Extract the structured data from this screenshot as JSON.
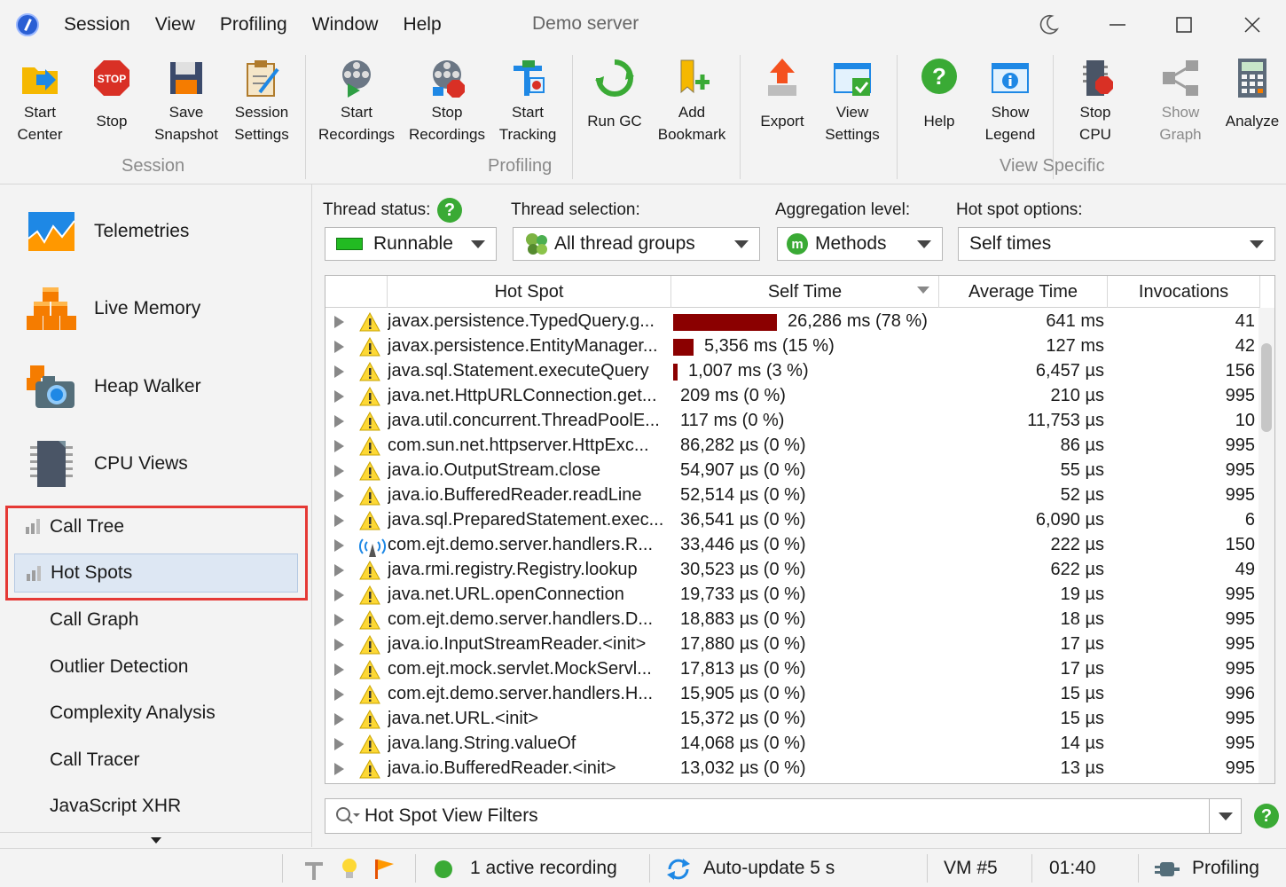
{
  "menu": [
    "Session",
    "View",
    "Profiling",
    "Window",
    "Help"
  ],
  "window_title": "Demo server",
  "ribbon": {
    "buttons": [
      {
        "label": "Start\nCenter",
        "icon": "folder-arrow-icon"
      },
      {
        "label": "Stop",
        "icon": "stop-sign-icon"
      },
      {
        "label": "Save\nSnapshot",
        "icon": "floppy-disk-icon"
      },
      {
        "label": "Session\nSettings",
        "icon": "clipboard-pencil-icon"
      },
      {
        "label": "Start\nRecordings",
        "icon": "film-reel-play-icon"
      },
      {
        "label": "Stop\nRecordings",
        "icon": "film-reel-stop-icon"
      },
      {
        "label": "Start\nTracking",
        "icon": "tracking-icon"
      },
      {
        "label": "Run GC",
        "icon": "recycle-icon"
      },
      {
        "label": "Add\nBookmark",
        "icon": "bookmark-add-icon"
      },
      {
        "label": "Export",
        "icon": "export-arrow-icon"
      },
      {
        "label": "View\nSettings",
        "icon": "view-settings-icon"
      },
      {
        "label": "Help",
        "icon": "help-icon"
      },
      {
        "label": "Show\nLegend",
        "icon": "legend-info-icon"
      },
      {
        "label": "Stop\nCPU",
        "icon": "cpu-stop-icon"
      },
      {
        "label": "Show\nGraph",
        "icon": "graph-share-icon"
      },
      {
        "label": "Analyze",
        "icon": "calculator-icon"
      }
    ],
    "groups": [
      "Session",
      "Profiling",
      "View Specific"
    ]
  },
  "sidebar": {
    "main": [
      {
        "label": "Telemetries",
        "icon": "telemetries-icon"
      },
      {
        "label": "Live Memory",
        "icon": "live-memory-icon"
      },
      {
        "label": "Heap Walker",
        "icon": "heap-walker-icon"
      },
      {
        "label": "CPU Views",
        "icon": "cpu-views-icon"
      }
    ],
    "sub": [
      "Call Tree",
      "Hot Spots",
      "Call Graph",
      "Outlier Detection",
      "Complexity Analysis",
      "Call Tracer",
      "JavaScript XHR"
    ]
  },
  "options": {
    "thread_status_label": "Thread status:",
    "thread_status_value": "Runnable",
    "thread_selection_label": "Thread selection:",
    "thread_selection_value": "All thread groups",
    "aggregation_label": "Aggregation level:",
    "aggregation_value": "Methods",
    "hotspot_label": "Hot spot options:",
    "hotspot_value": "Self times"
  },
  "table": {
    "headers": [
      "Hot Spot",
      "Self Time",
      "Average Time",
      "Invocations"
    ],
    "rows": [
      {
        "name": "javax.persistence.TypedQuery.g...",
        "self": "26,286 ms (78 %)",
        "pct": 78,
        "avg": "641 ms",
        "inv": "41",
        "icon": "warning-icon"
      },
      {
        "name": "javax.persistence.EntityManager...",
        "self": "5,356 ms (15 %)",
        "pct": 15,
        "avg": "127 ms",
        "inv": "42",
        "icon": "warning-icon"
      },
      {
        "name": "java.sql.Statement.executeQuery",
        "self": "1,007 ms (3 %)",
        "pct": 3,
        "avg": "6,457 µs",
        "inv": "156",
        "icon": "warning-icon"
      },
      {
        "name": "java.net.HttpURLConnection.get...",
        "self": "209 ms (0 %)",
        "pct": 0,
        "avg": "210 µs",
        "inv": "995",
        "icon": "warning-icon"
      },
      {
        "name": "java.util.concurrent.ThreadPoolE...",
        "self": "117 ms (0 %)",
        "pct": 0,
        "avg": "11,753 µs",
        "inv": "10",
        "icon": "warning-icon"
      },
      {
        "name": "com.sun.net.httpserver.HttpExc...",
        "self": "86,282 µs (0 %)",
        "pct": 0,
        "avg": "86 µs",
        "inv": "995",
        "icon": "warning-icon"
      },
      {
        "name": "java.io.OutputStream.close",
        "self": "54,907 µs (0 %)",
        "pct": 0,
        "avg": "55 µs",
        "inv": "995",
        "icon": "warning-icon"
      },
      {
        "name": "java.io.BufferedReader.readLine",
        "self": "52,514 µs (0 %)",
        "pct": 0,
        "avg": "52 µs",
        "inv": "995",
        "icon": "warning-icon"
      },
      {
        "name": "java.sql.PreparedStatement.exec...",
        "self": "36,541 µs (0 %)",
        "pct": 0,
        "avg": "6,090 µs",
        "inv": "6",
        "icon": "warning-icon"
      },
      {
        "name": "com.ejt.demo.server.handlers.R...",
        "self": "33,446 µs (0 %)",
        "pct": 0,
        "avg": "222 µs",
        "inv": "150",
        "icon": "antenna-icon"
      },
      {
        "name": "java.rmi.registry.Registry.lookup",
        "self": "30,523 µs (0 %)",
        "pct": 0,
        "avg": "622 µs",
        "inv": "49",
        "icon": "warning-icon"
      },
      {
        "name": "java.net.URL.openConnection",
        "self": "19,733 µs (0 %)",
        "pct": 0,
        "avg": "19 µs",
        "inv": "995",
        "icon": "warning-icon"
      },
      {
        "name": "com.ejt.demo.server.handlers.D...",
        "self": "18,883 µs (0 %)",
        "pct": 0,
        "avg": "18 µs",
        "inv": "995",
        "icon": "warning-icon"
      },
      {
        "name": "java.io.InputStreamReader.<init>",
        "self": "17,880 µs (0 %)",
        "pct": 0,
        "avg": "17 µs",
        "inv": "995",
        "icon": "warning-icon"
      },
      {
        "name": "com.ejt.mock.servlet.MockServl...",
        "self": "17,813 µs (0 %)",
        "pct": 0,
        "avg": "17 µs",
        "inv": "995",
        "icon": "warning-icon"
      },
      {
        "name": "com.ejt.demo.server.handlers.H...",
        "self": "15,905 µs (0 %)",
        "pct": 0,
        "avg": "15 µs",
        "inv": "996",
        "icon": "warning-icon"
      },
      {
        "name": "java.net.URL.<init>",
        "self": "15,372 µs (0 %)",
        "pct": 0,
        "avg": "15 µs",
        "inv": "995",
        "icon": "warning-icon"
      },
      {
        "name": "java.lang.String.valueOf",
        "self": "14,068 µs (0 %)",
        "pct": 0,
        "avg": "14 µs",
        "inv": "995",
        "icon": "warning-icon"
      },
      {
        "name": "java.io.BufferedReader.<init>",
        "self": "13,032 µs (0 %)",
        "pct": 0,
        "avg": "13 µs",
        "inv": "995",
        "icon": "warning-icon"
      }
    ]
  },
  "filter": {
    "placeholder": "Hot Spot View Filters"
  },
  "status": {
    "recording": "1 active recording",
    "auto_update": "Auto-update 5 s",
    "vm": "VM #5",
    "time": "01:40",
    "mode": "Profiling"
  },
  "colors": {
    "bar": "#8b0000",
    "accent_green": "#3aaa35",
    "highlight": "#e53935"
  }
}
